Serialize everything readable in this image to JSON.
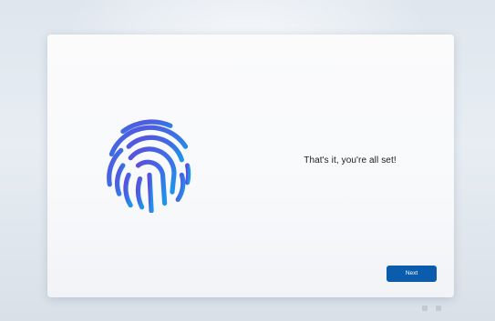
{
  "setup": {
    "message": "That's it, you're all set!",
    "next_label": "Next"
  },
  "colors": {
    "accent": "#0b5cad",
    "fingerprint_gradient": [
      "#4f62e0",
      "#1f8fe8"
    ]
  },
  "icons": {
    "illustration": "fingerprint-icon",
    "tray": [
      "accessibility-icon",
      "network-icon"
    ]
  }
}
